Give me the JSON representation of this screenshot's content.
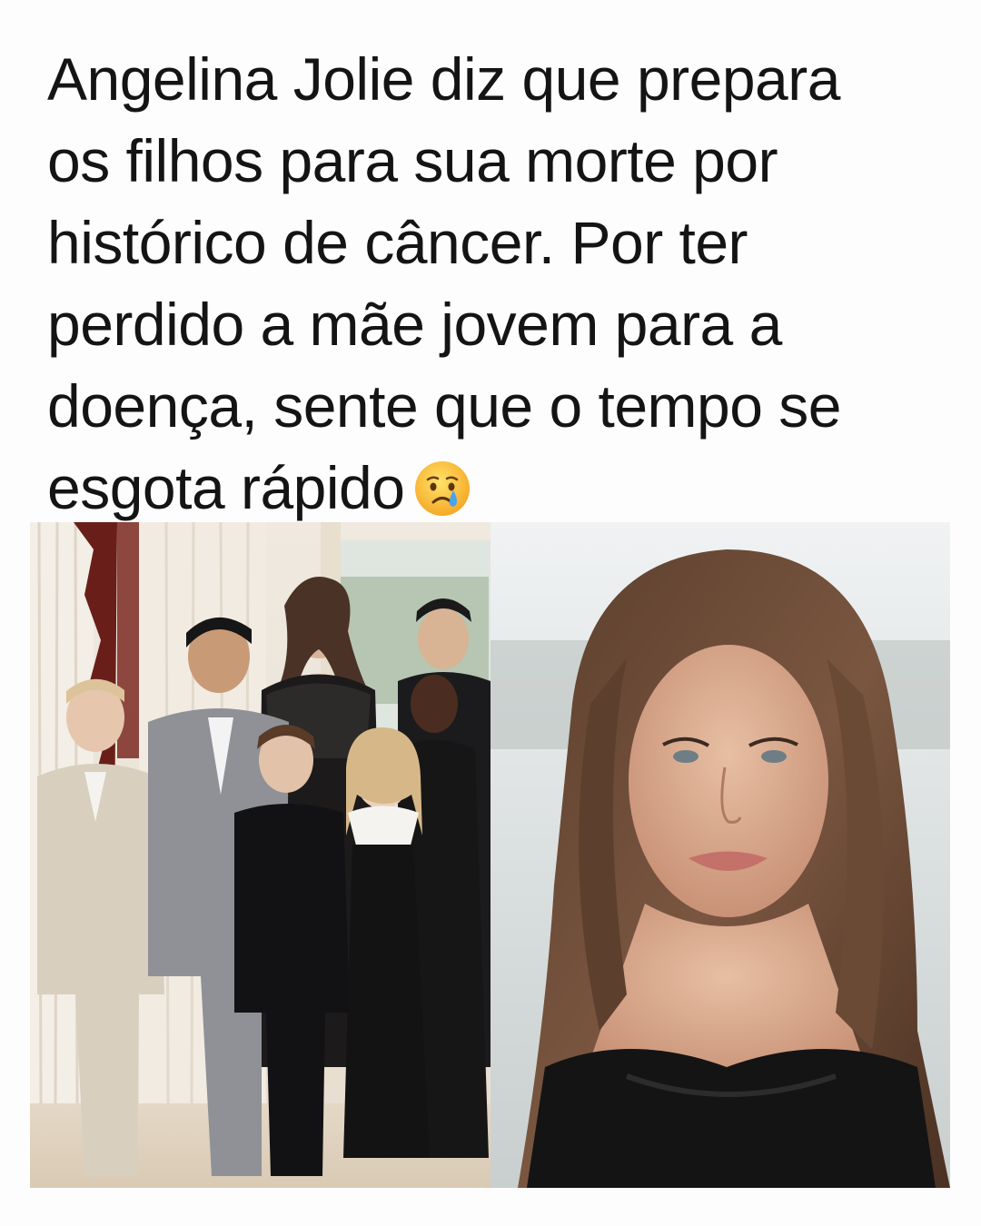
{
  "post": {
    "headline_lines": [
      "Angelina Jolie diz que prepara",
      "os filhos para sua morte por",
      "histórico de câncer. Por ter",
      "perdido a mãe jovem para a",
      "doença, sente que o tempo se",
      "esgota rápido"
    ],
    "emoji": "crying-face",
    "colors": {
      "background": "#fdfdfd",
      "text": "#141414"
    }
  },
  "images": [
    {
      "name": "family-photo",
      "subject": "woman in black lace dress with six children in suits and dresses"
    },
    {
      "name": "portrait-photo",
      "subject": "smiling woman with long brown hair in black strapless dress"
    }
  ]
}
